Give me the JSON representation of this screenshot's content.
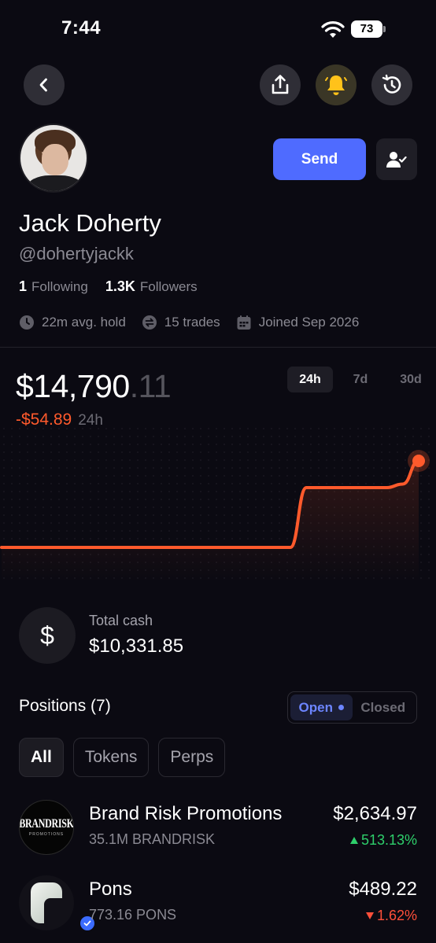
{
  "status_bar": {
    "time": "7:44",
    "battery": "73"
  },
  "profile": {
    "name": "Jack Doherty",
    "handle": "@dohertyjackk",
    "following_count": "1",
    "following_label": "Following",
    "followers_count": "1.3K",
    "followers_label": "Followers",
    "avg_hold": "22m avg. hold",
    "trades": "15 trades",
    "joined": "Joined Sep 2026",
    "send_label": "Send"
  },
  "portfolio": {
    "balance_main": "$14,790",
    "balance_cents": ".11",
    "change": "-$54.89",
    "change_period": "24h",
    "ranges": [
      "24h",
      "7d",
      "30d"
    ],
    "active_range": "24h"
  },
  "chart_data": {
    "type": "line",
    "color": "#ff5a2c",
    "values": [
      14741.2,
      14741.2,
      14741.2,
      14741.2,
      14741.2,
      14741.2,
      14741.2,
      14741.2,
      14741.2,
      14741.2,
      14741.2,
      14741.2,
      14741.2,
      14741.2,
      14741.2,
      14741.2,
      14741.2,
      14741.2,
      14741.2,
      14775.0,
      14775.0,
      14775.0,
      14775.0,
      14775.0,
      14775.0,
      14777.0,
      14790.11
    ]
  },
  "cash": {
    "label": "Total cash",
    "value": "$10,331.85"
  },
  "positions": {
    "title": "Positions (7)",
    "toggle": [
      "Open",
      "Closed"
    ],
    "filters": [
      "All",
      "Tokens",
      "Perps"
    ],
    "items": [
      {
        "name": "Brand Risk Promotions",
        "qty": "35.1M BRANDRISK",
        "value": "$2,634.97",
        "change": "513.13%",
        "direction": "up",
        "logo_text": "BRANDRISK",
        "logo_sub": "PROMOTIONS"
      },
      {
        "name": "Pons",
        "qty": "773.16 PONS",
        "value": "$489.22",
        "change": "1.62%",
        "direction": "down"
      }
    ]
  }
}
